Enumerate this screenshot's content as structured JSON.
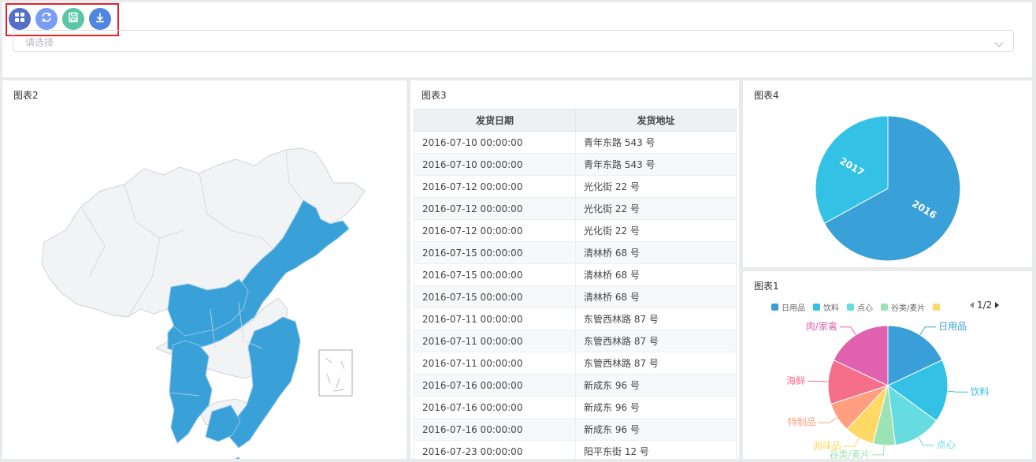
{
  "toolbar": {
    "buttons": [
      {
        "icon": "grid-icon",
        "color": "#5470c6"
      },
      {
        "icon": "refresh-icon",
        "color": "#7b9cf5"
      },
      {
        "icon": "save-icon",
        "color": "#5cc6a4"
      },
      {
        "icon": "download-icon",
        "color": "#4f86e0"
      }
    ]
  },
  "select": {
    "placeholder": "请选择"
  },
  "panels": {
    "chart2_title": "图表2",
    "chart3_title": "图表3",
    "chart4_title": "图表4",
    "chart1_title": "图表1"
  },
  "table": {
    "headers": [
      "发货日期",
      "发货地址"
    ],
    "rows": [
      [
        "2016-07-10 00:00:00",
        "青年东路 543 号"
      ],
      [
        "2016-07-10 00:00:00",
        "青年东路 543 号"
      ],
      [
        "2016-07-12 00:00:00",
        "光化街 22 号"
      ],
      [
        "2016-07-12 00:00:00",
        "光化街 22 号"
      ],
      [
        "2016-07-12 00:00:00",
        "光化街 22 号"
      ],
      [
        "2016-07-15 00:00:00",
        "清林桥 68 号"
      ],
      [
        "2016-07-15 00:00:00",
        "清林桥 68 号"
      ],
      [
        "2016-07-15 00:00:00",
        "清林桥 68 号"
      ],
      [
        "2016-07-11 00:00:00",
        "东管西林路 87 号"
      ],
      [
        "2016-07-11 00:00:00",
        "东管西林路 87 号"
      ],
      [
        "2016-07-11 00:00:00",
        "东管西林路 87 号"
      ],
      [
        "2016-07-16 00:00:00",
        "新成东 96 号"
      ],
      [
        "2016-07-16 00:00:00",
        "新成东 96 号"
      ],
      [
        "2016-07-16 00:00:00",
        "新成东 96 号"
      ],
      [
        "2016-07-23 00:00:00",
        "阳平东街 12 号"
      ]
    ]
  },
  "chart_data": [
    {
      "type": "pie",
      "categories": [
        "2016",
        "2017"
      ],
      "values": [
        67,
        33
      ],
      "colors": [
        "#3aa0d8",
        "#33c2e6"
      ]
    },
    {
      "type": "pie",
      "categories": [
        "日用品",
        "饮料",
        "点心",
        "谷类/麦片",
        "调味品",
        "特制品",
        "海鲜",
        "肉/家禽"
      ],
      "values": [
        18,
        17,
        13,
        6,
        8,
        8,
        12,
        18
      ],
      "colors": [
        "#3a9ed8",
        "#33c2e6",
        "#66dbe0",
        "#9be3b4",
        "#ffd966",
        "#ff9f7f",
        "#f56f8a",
        "#e062ae"
      ],
      "legend_visible": [
        "日用品",
        "饮料",
        "点心",
        "谷类/麦片"
      ],
      "legend_page": "1/2"
    }
  ],
  "map": {
    "highlight_color": "#3aa0d8",
    "base_color": "#f2f3f5",
    "border_color": "#cfd3d8"
  }
}
